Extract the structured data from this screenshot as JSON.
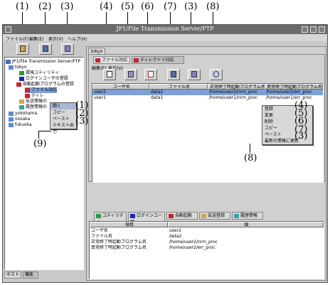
{
  "window": {
    "title": "JP1/File Transmission Server/FTP"
  },
  "menu": {
    "file": "ファイル(F)",
    "edit": "編集(E)",
    "view": "表示(V)",
    "help": "ヘルプ(H)"
  },
  "callouts": {
    "n1": "(1)",
    "n2": "(2)",
    "n3": "(3)",
    "n4": "(4)",
    "n5": "(5)",
    "n6": "(6)",
    "n7": "(7)",
    "n8": "(8)",
    "n9": "(9)"
  },
  "tree": {
    "root": "JP1/File Transmission Server/FTP",
    "host_tokyo": "tokyo",
    "env_utility": "環境ユティリティ",
    "login_user": "ログインユーザの登録",
    "auto_start": "自動起動プログラムの登録",
    "file_map": "ファイル対応",
    "dir_map": "ディレ",
    "transfer_reg": "伝送情報の",
    "history": "履歴情報の",
    "host_yokohama": "yokohama",
    "host_oosaka": "oosaka",
    "host_fukuoka": "fukuoka"
  },
  "tree_context": {
    "open": "開く",
    "copy": "コピー",
    "paste": "ペースト",
    "text_out": "テキスト出力"
  },
  "left_tabs": {
    "host": "ホスト",
    "function": "機能"
  },
  "right": {
    "host_tab": "tokyo",
    "tab_file": "ファイル対応",
    "tab_dir": "ディレクトリ対応",
    "menu_edit": "編集(E)",
    "menu_view": "表示(V)"
  },
  "file_table": {
    "headers": [
      "ユーザ名",
      "ファイル名",
      "正常終了時起動プログラム名",
      "異常終了時起動プログラム名"
    ],
    "rows": [
      [
        "user2",
        "data2",
        "/home/user2/nrm_proc",
        "/home/user2/err_proc"
      ],
      [
        "user1",
        "data1",
        "/home/user1/nrm_proc",
        "/home/user1/err_proc"
      ]
    ]
  },
  "table_context": {
    "register": "登録",
    "change": "変更",
    "delete": "削除",
    "copy": "コピー",
    "paste": "ペースト",
    "refresh": "最新の情報に更新"
  },
  "bottom_tabs": [
    "ユティリティ",
    "ログインユーザ",
    "自動起動",
    "伝送登録",
    "履歴情報"
  ],
  "detail_table": {
    "headers": [
      "項目",
      "値"
    ],
    "rows": [
      [
        "ユーザ名",
        "user2"
      ],
      [
        "ファイル名",
        "data2"
      ],
      [
        "正常終了時起動プログラム名",
        "/home/user2/nrm_proc"
      ],
      [
        "異常終了時起動プログラム名",
        "/home/user2/err_proc"
      ]
    ]
  },
  "colors": {
    "selection": "#7f9fd6",
    "titlebar": "#6b6b6b",
    "window": "#c9c9c9",
    "blue_icon": "#1c2aa8",
    "red_icon": "#c0262c"
  }
}
